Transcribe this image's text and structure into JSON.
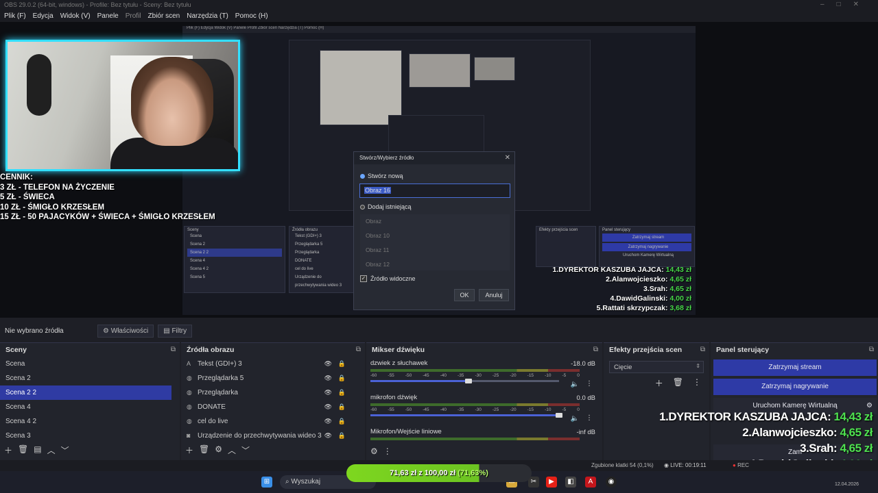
{
  "window": {
    "title": "OBS 29.0.2 (64-bit, windows) - Profile: Bez tytułu - Sceny: Bez tytułu"
  },
  "menu": [
    {
      "label": "Plik (F)",
      "enabled": true
    },
    {
      "label": "Edycja",
      "enabled": true
    },
    {
      "label": "Widok (V)",
      "enabled": true
    },
    {
      "label": "Panele",
      "enabled": true
    },
    {
      "label": "Profil",
      "enabled": false
    },
    {
      "label": "Zbiór scen",
      "enabled": true
    },
    {
      "label": "Narzędzia (T)",
      "enabled": true
    },
    {
      "label": "Pomoc (H)",
      "enabled": true
    }
  ],
  "overlay": {
    "cennik": [
      "CENNIK:",
      "3 ZŁ - TELEFON NA ŻYCZENIE",
      "5 ZŁ - ŚWIECA",
      "10 ZŁ - ŚMIGŁO KRZESŁEM",
      "15 ZŁ - 50 PAJACYKÓW + ŚWIECA + ŚMIGŁO KRZESŁEM"
    ],
    "ranking": [
      {
        "label": "1.DYREKTOR KASZUBA JAJCA:",
        "amount": "14,43 zł"
      },
      {
        "label": "2.Alanwojcieszko:",
        "amount": "4,65 zł"
      },
      {
        "label": "3.Srah:",
        "amount": "4,65 zł"
      },
      {
        "label": "4.DawidGalinski:",
        "amount": "4,00 zł"
      },
      {
        "label": "5.Rattati skrzypczak:",
        "amount": "3,68 zł"
      }
    ],
    "goal": {
      "current": "71,63 zł",
      "sep": "z",
      "target": "100,00 zł",
      "percent": "(71,63%)",
      "fraction": 0.7163
    }
  },
  "nested": {
    "menu": "Plik (F)   Edycja   Widok (V)   Panele   Profil   Zbiór scen   Narzędzia (T)   Pomoc (H)",
    "scenes": [
      "Scena",
      "Scena 2",
      "Scena 2 2",
      "Scena 4",
      "Scena 4 2",
      "Scena 5"
    ],
    "sources": [
      "Tekst (GDI+) 3",
      "Przeglądarka 5",
      "Przeglądarka",
      "DONATE",
      "cel do live",
      "Urządzenie do przechwytywania wideo 3"
    ],
    "scenes_title": "Sceny",
    "sources_title": "Źródła obrazu",
    "transitions_title": "Efekty przejścia scen",
    "controls_title": "Panel sterujący",
    "stop_stream": "Zatrzymaj stream",
    "stop_rec": "Zatrzymaj nagrywanie",
    "vcam": "Uruchom Kamerę Wirtualną"
  },
  "dialog": {
    "title": "Stwórz/Wybierz źródło",
    "create_new": "Stwórz nową",
    "name_value": "Obraz 16",
    "add_existing": "Dodaj istniejącą",
    "existing": [
      "Obraz",
      "Obraz 10",
      "Obraz 11",
      "Obraz 12"
    ],
    "visible_label": "Źródło widoczne",
    "ok": "OK",
    "cancel": "Anuluj"
  },
  "source_bar": {
    "no_source": "Nie wybrano źródła",
    "properties": "Właściwości",
    "filters": "Filtry"
  },
  "scenes": {
    "title": "Sceny",
    "items": [
      "Scena",
      "Scena 2",
      "Scena 2 2",
      "Scena 4",
      "Scena 4 2",
      "Scena 3"
    ],
    "selected": 2
  },
  "sources": {
    "title": "Źródła obrazu",
    "items": [
      {
        "name": "Tekst (GDI+) 3",
        "icon": "text-icon"
      },
      {
        "name": "Przeglądarka 5",
        "icon": "globe-icon"
      },
      {
        "name": "Przeglądarka",
        "icon": "globe-icon"
      },
      {
        "name": "DONATE",
        "icon": "globe-icon"
      },
      {
        "name": "cel do live",
        "icon": "globe-icon"
      },
      {
        "name": "Urządzenie do przechwytywania wideo 3",
        "icon": "camera-icon"
      }
    ]
  },
  "mixer": {
    "title": "Mikser dźwięku",
    "scale": [
      "-60",
      "-55",
      "-50",
      "-45",
      "-40",
      "-35",
      "-30",
      "-25",
      "-20",
      "-15",
      "-10",
      "-5",
      "0"
    ],
    "channels": [
      {
        "name": "dzwiek z słuchawek",
        "db": "-18.0 dB",
        "level": 0.52
      },
      {
        "name": "mikrofon dźwięk",
        "db": "0.0 dB",
        "level": 1.0
      },
      {
        "name": "Mikrofon/Wejście liniowe",
        "db": "-inf dB",
        "level": 0.0
      }
    ]
  },
  "transitions": {
    "title": "Efekty przejścia scen",
    "selected": "Cięcie"
  },
  "controls": {
    "title": "Panel sterujący",
    "stop_stream": "Zatrzymaj stream",
    "stop_recording": "Zatrzymaj nagrywanie",
    "virtual_camera": "Uruchom Kamerę Wirtualną",
    "studio": "Zam"
  },
  "status": {
    "dropped": "Zgubione klatki 54 (0,1%)",
    "live": "LIVE: 00:19:11",
    "rec": "REC"
  },
  "taskbar": {
    "search": "Wyszukaj",
    "date": "12.04.2026"
  },
  "colors": {
    "accent": "#2f3ba3",
    "glow": "#33e0ff",
    "green": "#4ee14f"
  }
}
